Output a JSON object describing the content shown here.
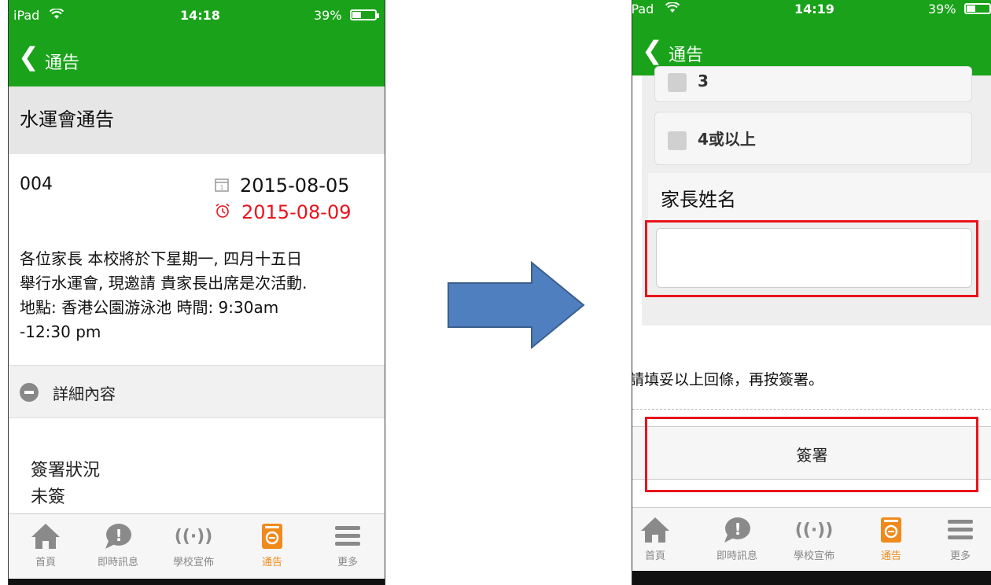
{
  "status_left": "iPad",
  "nav_title": "通告",
  "screen1": {
    "time": "14:18",
    "battery": "39%",
    "notice_title": "水運會通告",
    "notice_no": "004",
    "issue_date": "2015-08-05",
    "due_date": "2015-08-09",
    "body_lines": [
      "各位家長 本校將於下星期一, 四月十五日",
      "舉行水運會, 現邀請 貴家長出席是次活動.",
      "地點: 香港公園游泳池 時間: 9:30am",
      "-12:30 pm"
    ],
    "details_label": "詳細內容",
    "sign_status_label": "簽署狀況",
    "sign_status_value": "未簽"
  },
  "screen2": {
    "time": "14:19",
    "battery": "39%",
    "option_3": "3",
    "option_4": "4或以上",
    "parent_name_label": "家長姓名",
    "parent_name_value": "",
    "instruction": "請填妥以上回條，再按簽署。",
    "sign_button": "簽署"
  },
  "tabs": [
    {
      "label": "首頁",
      "icon": "home-icon"
    },
    {
      "label": "即時訊息",
      "icon": "message-icon"
    },
    {
      "label": "學校宣佈",
      "icon": "broadcast-icon"
    },
    {
      "label": "通告",
      "icon": "notice-icon"
    },
    {
      "label": "更多",
      "icon": "menu-icon"
    }
  ],
  "colors": {
    "brand_green": "#1aa31a",
    "active_tab": "#f08a1c",
    "due_red": "#e8141c",
    "highlight_box": "#e8141c",
    "arrow_blue": "#4f7fbf"
  }
}
